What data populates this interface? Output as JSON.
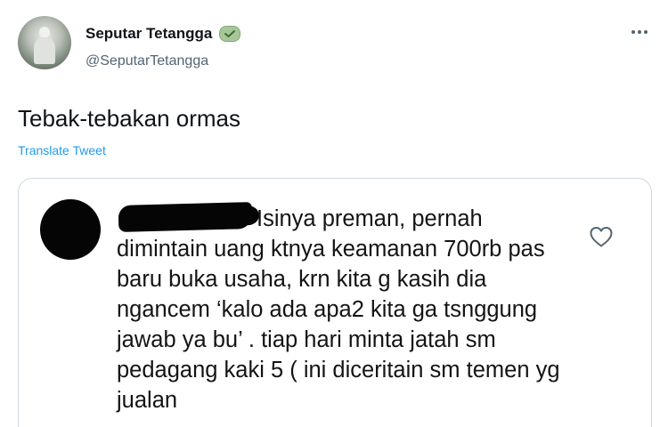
{
  "tweet": {
    "display_name": "Seputar Tetangga",
    "handle": "@SeputarTetangga",
    "text": "Tebak-tebakan ormas",
    "translate_label": "Translate Tweet",
    "badge_icon": "verified-badge-icon",
    "more_icon": "more-options-icon"
  },
  "quoted": {
    "text": "Isinya preman, pernah dimintain uang ktnya keamanan 700rb pas baru buka usaha, krn kita g kasih dia ngancem ‘kalo ada apa2 kita ga tsnggung jawab ya bu’ . tiap hari minta jatah sm pedagang kaki 5 ( ini diceritain sm temen yg jualan",
    "like_icon": "heart-icon"
  },
  "colors": {
    "link": "#1d9bf0",
    "secondary_text": "#536471",
    "border": "#cfd9de",
    "redaction": "#050505"
  }
}
